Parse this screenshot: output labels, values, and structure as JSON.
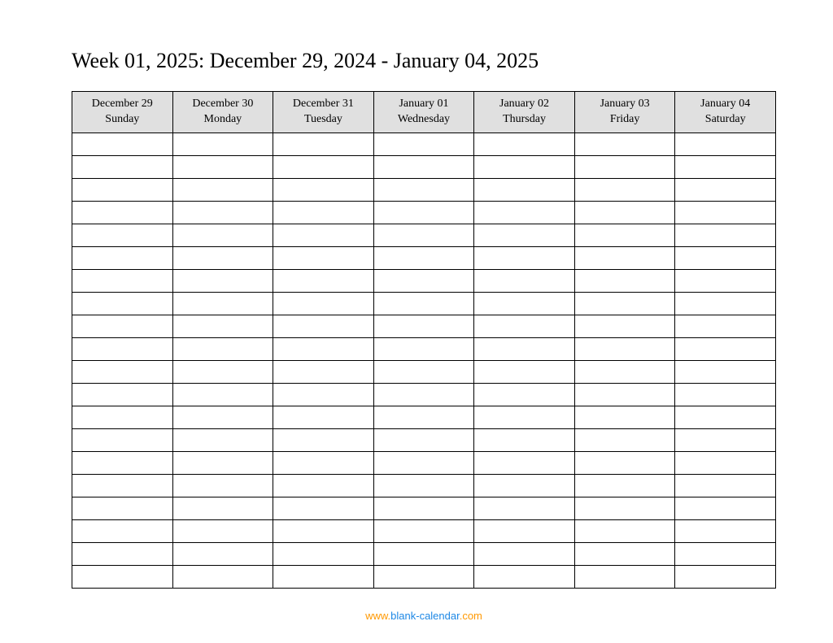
{
  "title": "Week 01, 2025: December 29, 2024 - January 04, 2025",
  "days": [
    {
      "date": "December 29",
      "weekday": "Sunday"
    },
    {
      "date": "December 30",
      "weekday": "Monday"
    },
    {
      "date": "December 31",
      "weekday": "Tuesday"
    },
    {
      "date": "January 01",
      "weekday": "Wednesday"
    },
    {
      "date": "January 02",
      "weekday": "Thursday"
    },
    {
      "date": "January 03",
      "weekday": "Friday"
    },
    {
      "date": "January 04",
      "weekday": "Saturday"
    }
  ],
  "blank_row_count": 20,
  "footer": {
    "prefix": "www.",
    "brand": "blank-calendar",
    "suffix": ".com"
  }
}
